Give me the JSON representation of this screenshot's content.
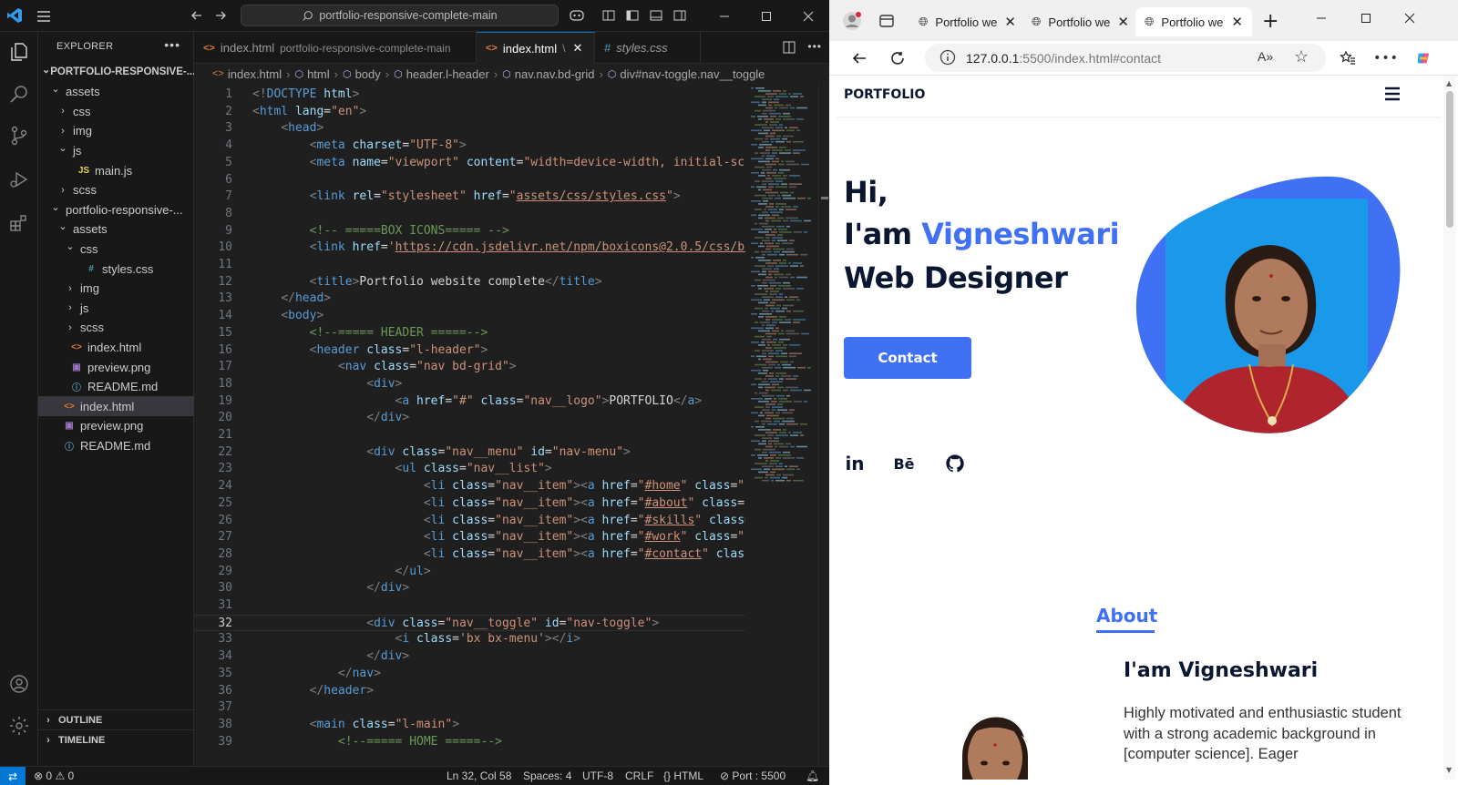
{
  "vscode": {
    "search_text": "portfolio-responsive-complete-main",
    "explorer_title": "EXPLORER",
    "tree": [
      {
        "label": "PORTFOLIO-RESPONSIVE-...",
        "kind": "root",
        "depth": 0,
        "expanded": true
      },
      {
        "label": "assets",
        "kind": "folder",
        "depth": 1,
        "expanded": true
      },
      {
        "label": "css",
        "kind": "folder",
        "depth": 2,
        "expanded": false
      },
      {
        "label": "img",
        "kind": "folder",
        "depth": 2,
        "expanded": false
      },
      {
        "label": "js",
        "kind": "folder",
        "depth": 2,
        "expanded": true
      },
      {
        "label": "main.js",
        "kind": "js",
        "depth": 3
      },
      {
        "label": "scss",
        "kind": "folder",
        "depth": 2,
        "expanded": false
      },
      {
        "label": "portfolio-responsive-...",
        "kind": "folder",
        "depth": 1,
        "expanded": true
      },
      {
        "label": "assets",
        "kind": "folder",
        "depth": 2,
        "expanded": true
      },
      {
        "label": "css",
        "kind": "folder",
        "depth": 3,
        "expanded": true
      },
      {
        "label": "styles.css",
        "kind": "css",
        "depth": 4
      },
      {
        "label": "img",
        "kind": "folder",
        "depth": 3,
        "expanded": false
      },
      {
        "label": "js",
        "kind": "folder",
        "depth": 3,
        "expanded": false
      },
      {
        "label": "scss",
        "kind": "folder",
        "depth": 3,
        "expanded": false
      },
      {
        "label": "index.html",
        "kind": "html",
        "depth": 2
      },
      {
        "label": "preview.png",
        "kind": "png",
        "depth": 2
      },
      {
        "label": "README.md",
        "kind": "md",
        "depth": 2
      },
      {
        "label": "index.html",
        "kind": "html",
        "depth": 1,
        "selected": true
      },
      {
        "label": "preview.png",
        "kind": "png",
        "depth": 1
      },
      {
        "label": "README.md",
        "kind": "md",
        "depth": 1
      }
    ],
    "outline_label": "OUTLINE",
    "timeline_label": "TIMELINE",
    "tabs": [
      {
        "label": "index.html",
        "desc": "portfolio-responsive-complete-main",
        "active": false,
        "kind": "html"
      },
      {
        "label": "index.html",
        "desc": "\\",
        "active": true,
        "kind": "html"
      },
      {
        "label": "styles.css",
        "desc": "",
        "active": false,
        "kind": "css"
      }
    ],
    "breadcrumb": [
      "index.html",
      "html",
      "body",
      "header.l-header",
      "nav.nav.bd-grid",
      "div#nav-toggle.nav__toggle"
    ],
    "current_line": 32,
    "code_lines": [
      "<!DOCTYPE html>",
      "<html lang=\"en\">",
      "    <head>",
      "        <meta charset=\"UTF-8\">",
      "        <meta name=\"viewport\" content=\"width=device-width, initial-sca",
      "",
      "        <link rel=\"stylesheet\" href=\"assets/css/styles.css\">",
      "",
      "        <!-- =====BOX ICONS===== -->",
      "        <link href='https://cdn.jsdelivr.net/npm/boxicons@2.0.5/css/bo",
      "",
      "        <title>Portfolio website complete</title>",
      "    </head>",
      "    <body>",
      "        <!--===== HEADER =====-->",
      "        <header class=\"l-header\">",
      "            <nav class=\"nav bd-grid\">",
      "                <div>",
      "                    <a href=\"#\" class=\"nav__logo\">PORTFOLIO</a>",
      "                </div>",
      "",
      "                <div class=\"nav__menu\" id=\"nav-menu\">",
      "                    <ul class=\"nav__list\">",
      "                        <li class=\"nav__item\"><a href=\"#home\" class=\"n",
      "                        <li class=\"nav__item\"><a href=\"#about\" class=\"",
      "                        <li class=\"nav__item\"><a href=\"#skills\" class=",
      "                        <li class=\"nav__item\"><a href=\"#work\" class=\"n",
      "                        <li class=\"nav__item\"><a href=\"#contact\" class",
      "                    </ul>",
      "                </div>",
      "",
      "                <div class=\"nav__toggle\" id=\"nav-toggle\">",
      "                    <i class='bx bx-menu'></i>",
      "                </div>",
      "            </nav>",
      "        </header>",
      "",
      "        <main class=\"l-main\">",
      "            <!--===== HOME =====-->"
    ],
    "status": {
      "errors": "0",
      "warnings": "0",
      "position": "Ln 32, Col 58",
      "spaces": "Spaces: 4",
      "encoding": "UTF-8",
      "eol": "CRLF",
      "language": "HTML",
      "port": "Port : 5500"
    }
  },
  "browser": {
    "tabs": [
      {
        "label": "Portfolio we",
        "active": false
      },
      {
        "label": "Portfolio we",
        "active": false
      },
      {
        "label": "Portfolio we",
        "active": true
      }
    ],
    "url_host": "127.0.0.1",
    "url_rest": ":5500/index.html#contact",
    "page": {
      "logo": "PORTFOLIO",
      "hero_hi": "Hi,",
      "hero_iam": "I'am ",
      "hero_name": "Vigneshwari",
      "hero_role": "Web Designer",
      "contact_button": "Contact",
      "social": [
        "in",
        "Bē",
        "github"
      ],
      "about_title": "About",
      "about_name": "I'am Vigneshwari",
      "about_text": "Highly motivated and enthusiastic student with a strong academic background in [computer science]. Eager"
    },
    "colors": {
      "accent": "#4070f4",
      "dark": "#0b1630"
    }
  }
}
